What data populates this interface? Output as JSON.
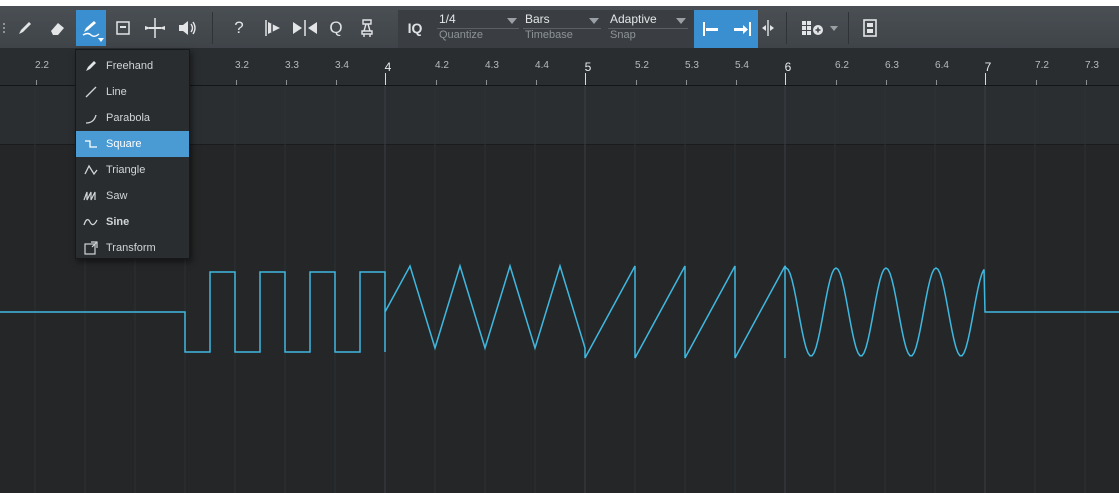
{
  "toolbar": {
    "tools": [
      {
        "icon": "grip-icon",
        "active": false
      },
      {
        "icon": "pencil-icon",
        "active": false
      },
      {
        "icon": "eraser-icon",
        "active": false
      },
      {
        "icon": "paint-tool-icon",
        "active": true
      },
      {
        "icon": "box-select-icon",
        "active": false
      },
      {
        "icon": "split-icon",
        "active": false
      },
      {
        "icon": "speaker-icon",
        "active": false
      }
    ],
    "help_label": "?",
    "iq_label": "IQ",
    "q_label": "Q",
    "quantize": {
      "value": "1/4",
      "caption": "Quantize"
    },
    "timebase": {
      "value": "Bars",
      "caption": "Timebase"
    },
    "snap": {
      "value": "Adaptive",
      "caption": "Snap"
    }
  },
  "ruler": {
    "labels": [
      "2.2",
      "3.2",
      "3.3",
      "3.4",
      "4",
      "4.2",
      "4.3",
      "4.4",
      "5",
      "5.2",
      "5.3",
      "5.4",
      "6",
      "6.2",
      "6.3",
      "6.4",
      "7",
      "7.2",
      "7.3"
    ],
    "major": [
      "4",
      "5",
      "6",
      "7"
    ]
  },
  "shape_menu": {
    "items": [
      {
        "label": "Freehand",
        "icon": "pencil-icon",
        "selected": false,
        "bold": false
      },
      {
        "label": "Line",
        "icon": "line-icon",
        "selected": false,
        "bold": false
      },
      {
        "label": "Parabola",
        "icon": "parabola-icon",
        "selected": false,
        "bold": false
      },
      {
        "label": "Square",
        "icon": "square-wave-icon",
        "selected": true,
        "bold": false
      },
      {
        "label": "Triangle",
        "icon": "triangle-wave-icon",
        "selected": false,
        "bold": false
      },
      {
        "label": "Saw",
        "icon": "saw-wave-icon",
        "selected": false,
        "bold": false
      },
      {
        "label": "Sine",
        "icon": "sine-wave-icon",
        "selected": false,
        "bold": true
      },
      {
        "label": "Transform",
        "icon": "transform-icon",
        "selected": false,
        "bold": false
      }
    ]
  },
  "colors": {
    "accent": "#3a8fd0",
    "curve": "#3fb8e0",
    "menu_selected": "#4a9ad4"
  }
}
